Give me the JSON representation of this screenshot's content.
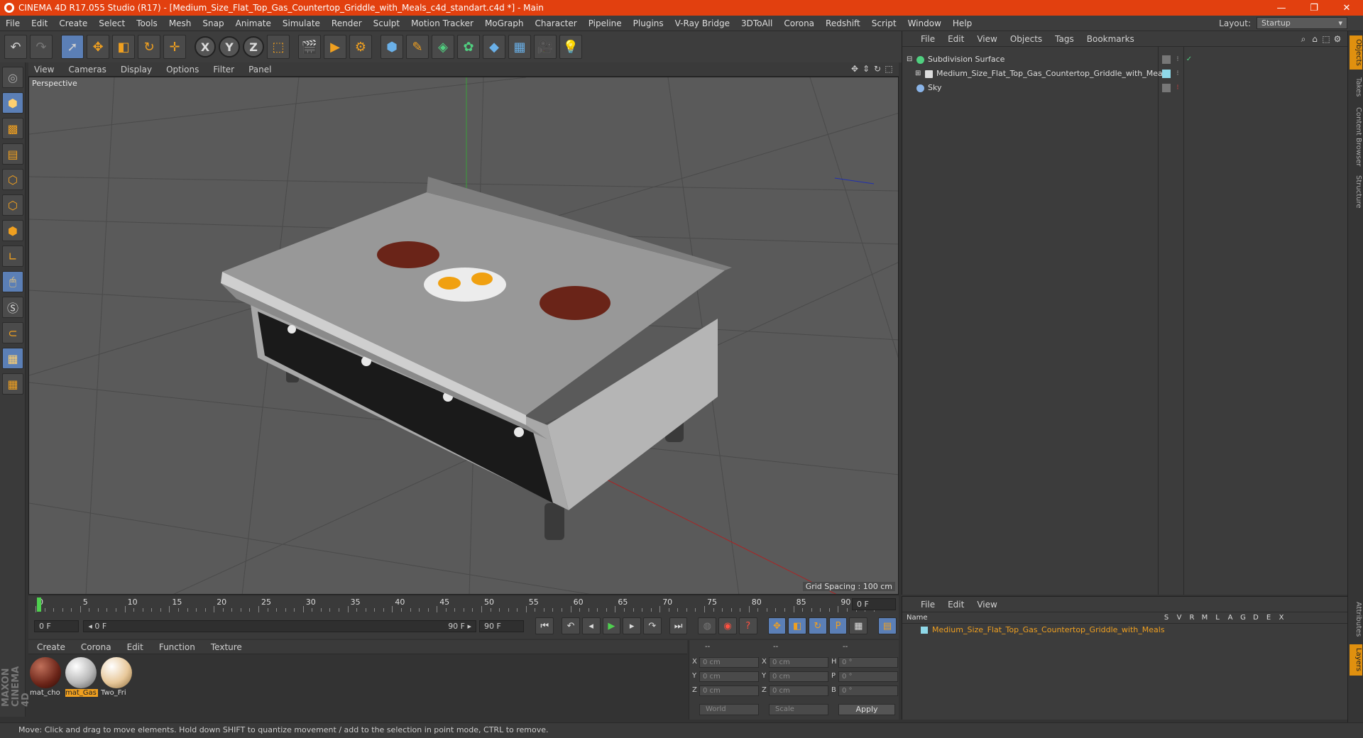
{
  "titlebar": {
    "title": "CINEMA 4D R17.055 Studio (R17) - [Medium_Size_Flat_Top_Gas_Countertop_Griddle_with_Meals_c4d_standart.c4d *] - Main",
    "minimize": "—",
    "maximize": "❐",
    "close": "✕"
  },
  "menu": [
    "File",
    "Edit",
    "Create",
    "Select",
    "Tools",
    "Mesh",
    "Snap",
    "Animate",
    "Simulate",
    "Render",
    "Sculpt",
    "Motion Tracker",
    "MoGraph",
    "Character",
    "Pipeline",
    "Plugins",
    "V-Ray Bridge",
    "3DToAll",
    "Corona",
    "Redshift",
    "Script",
    "Window",
    "Help"
  ],
  "layout": {
    "label": "Layout:",
    "value": "Startup"
  },
  "toolbar_icons": [
    "undo-icon",
    "redo-icon",
    "select-icon",
    "move-icon",
    "scale-icon",
    "rotate-icon",
    "live-select-icon",
    "x-axis-icon",
    "y-axis-icon",
    "z-axis-icon",
    "coordinate-system-icon",
    "render-view-icon",
    "render-picture-viewer-icon",
    "edit-render-settings-icon",
    "cube-icon",
    "pen-icon",
    "subdivision-icon",
    "mograph-icon",
    "deformer-icon",
    "floor-icon",
    "camera-icon",
    "light-icon"
  ],
  "axis_labels": {
    "x": "X",
    "y": "Y",
    "z": "Z"
  },
  "viewport": {
    "menu": [
      "View",
      "Cameras",
      "Display",
      "Options",
      "Filter",
      "Panel"
    ],
    "label": "Perspective",
    "grid_spacing": "Grid Spacing : 100 cm"
  },
  "timeline": {
    "ticks": [
      "0",
      "5",
      "10",
      "15",
      "20",
      "25",
      "30",
      "35",
      "40",
      "45",
      "50",
      "55",
      "60",
      "65",
      "70",
      "75",
      "80",
      "85",
      "90"
    ],
    "current_frame": "0 F"
  },
  "transport": {
    "start_frame": "0 F",
    "range_start": "◂ 0 F",
    "range_end": "90 F ▸",
    "end_frame": "90 F"
  },
  "materials": {
    "menu": [
      "Create",
      "Corona",
      "Edit",
      "Function",
      "Texture"
    ],
    "items": [
      {
        "name": "mat_cho",
        "color": "#6a2418",
        "selected": false
      },
      {
        "name": "mat_Gas",
        "color": "#b8b8b8",
        "selected": true
      },
      {
        "name": "Two_Fri",
        "color": "#e8c89a",
        "selected": false
      }
    ]
  },
  "coordinates": {
    "headers": [
      "--",
      "--",
      "--"
    ],
    "rows": [
      {
        "a": "X",
        "av": "0 cm",
        "b": "X",
        "bv": "0 cm",
        "c": "H",
        "cv": "0 °"
      },
      {
        "a": "Y",
        "av": "0 cm",
        "b": "Y",
        "bv": "0 cm",
        "c": "P",
        "cv": "0 °"
      },
      {
        "a": "Z",
        "av": "0 cm",
        "b": "Z",
        "bv": "0 cm",
        "c": "B",
        "cv": "0 °"
      }
    ],
    "space": "World",
    "mode": "Scale",
    "apply": "Apply"
  },
  "object_manager": {
    "menu": [
      "File",
      "Edit",
      "View",
      "Objects",
      "Tags",
      "Bookmarks"
    ],
    "objects": [
      {
        "name": "Subdivision Surface",
        "color": "#50d080",
        "indent": 0
      },
      {
        "name": "Medium_Size_Flat_Top_Gas_Countertop_Griddle_with_Meals",
        "color": "#dddddd",
        "indent": 1
      },
      {
        "name": "Sky",
        "color": "#8ab4e8",
        "indent": 0
      }
    ]
  },
  "right_tabs": [
    "Objects",
    "Takes",
    "Content Browser",
    "Structure",
    "Attributes",
    "Layers"
  ],
  "layer_manager": {
    "menu": [
      "File",
      "Edit",
      "View"
    ],
    "name_col": "Name",
    "cols": [
      "S",
      "V",
      "R",
      "M",
      "L",
      "A",
      "G",
      "D",
      "E",
      "X"
    ],
    "layer": "Medium_Size_Flat_Top_Gas_Countertop_Griddle_with_Meals"
  },
  "status": "Move: Click and drag to move elements. Hold down SHIFT to quantize movement / add to the selection in point mode, CTRL to remove.",
  "maxon": "MAXON CINEMA 4D",
  "colors": {
    "title_bar": "#e2400f",
    "accent": "#f0a020",
    "viewport_bg": "#5a5a5a"
  }
}
